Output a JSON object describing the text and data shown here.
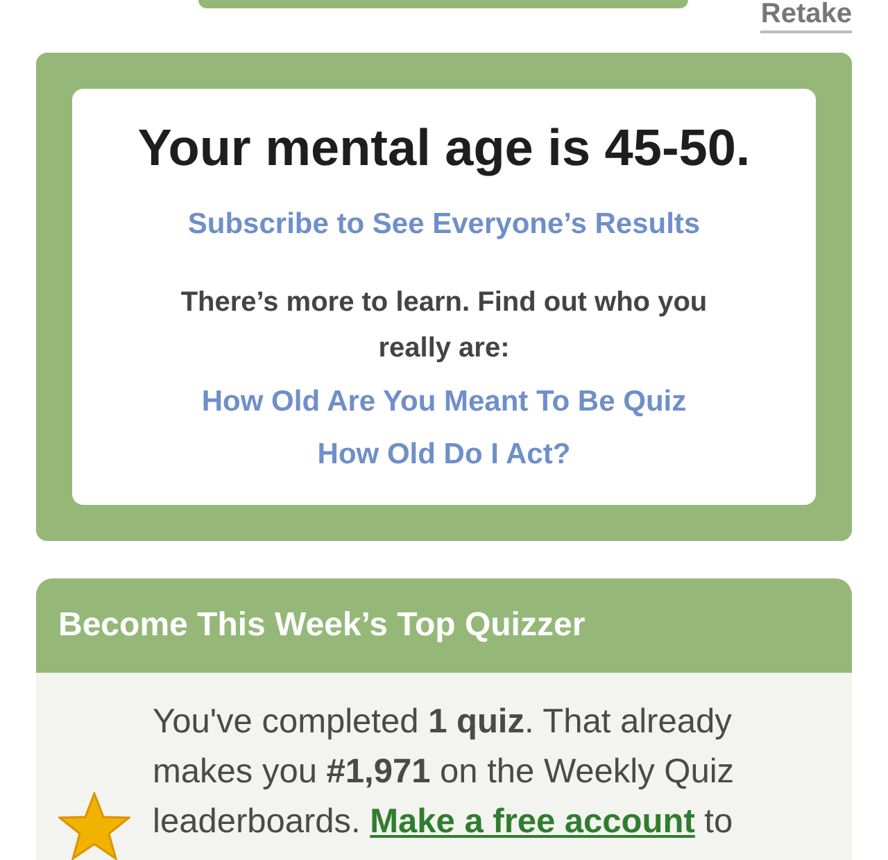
{
  "top_bar": {
    "retake_link": "Retake"
  },
  "result": {
    "title": "Your mental age is 45-50.",
    "subscribe_link": "Subscribe to See Everyone’s Results",
    "prompt": "There’s more to learn. Find out who you really are:",
    "links": [
      "How Old Are You Meant To Be Quiz",
      "How Old Do I Act?"
    ]
  },
  "leaderboard": {
    "title": "Become This Week’s Top Quizzer",
    "text": "You've completed **1 quiz**. That already makes you **#1,971** on the Weekly Quiz leaderboards.",
    "link": "Make a free account",
    "tail": "to"
  }
}
